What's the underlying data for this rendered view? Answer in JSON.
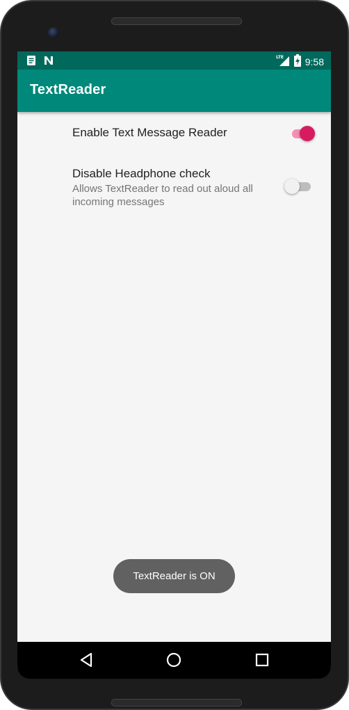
{
  "status_bar": {
    "time": "9:58",
    "network": "LTE",
    "battery_charging": true,
    "notification_icons": [
      "document-icon",
      "n-icon"
    ]
  },
  "app_bar": {
    "title": "TextReader"
  },
  "preferences": [
    {
      "title": "Enable Text Message Reader",
      "summary": "",
      "checked": true
    },
    {
      "title": "Disable Headphone check",
      "summary": "Allows TextReader to read out aloud all incoming messages",
      "checked": false
    }
  ],
  "toast": {
    "message": "TextReader is ON"
  },
  "nav_bar": {
    "buttons": [
      "back-icon",
      "home-icon",
      "recents-icon"
    ]
  },
  "colors": {
    "primary": "#00897b",
    "primary_dark": "#00695c",
    "accent": "#d81b60",
    "accent_light": "#f48fb1",
    "switch_off_thumb": "#f1f1f1",
    "switch_off_track": "#bdbdbd"
  }
}
